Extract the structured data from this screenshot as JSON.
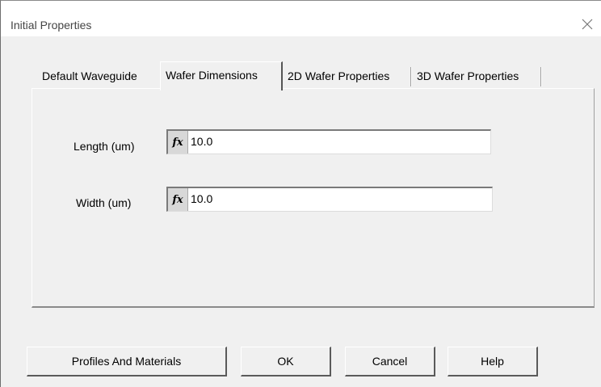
{
  "window": {
    "title": "Initial Properties"
  },
  "tabs": [
    {
      "label": "Default Waveguide"
    },
    {
      "label": "Wafer Dimensions"
    },
    {
      "label": "2D Wafer Properties"
    },
    {
      "label": "3D Wafer Properties"
    }
  ],
  "active_tab": "Wafer Dimensions",
  "fields": {
    "length": {
      "label": "Length (um)",
      "value": "10.0",
      "fx_label": "fx"
    },
    "width": {
      "label": "Width (um)",
      "value": "10.0",
      "fx_label": "fx"
    }
  },
  "buttons": {
    "profiles": "Profiles And Materials",
    "ok": "OK",
    "cancel": "Cancel",
    "help": "Help"
  }
}
